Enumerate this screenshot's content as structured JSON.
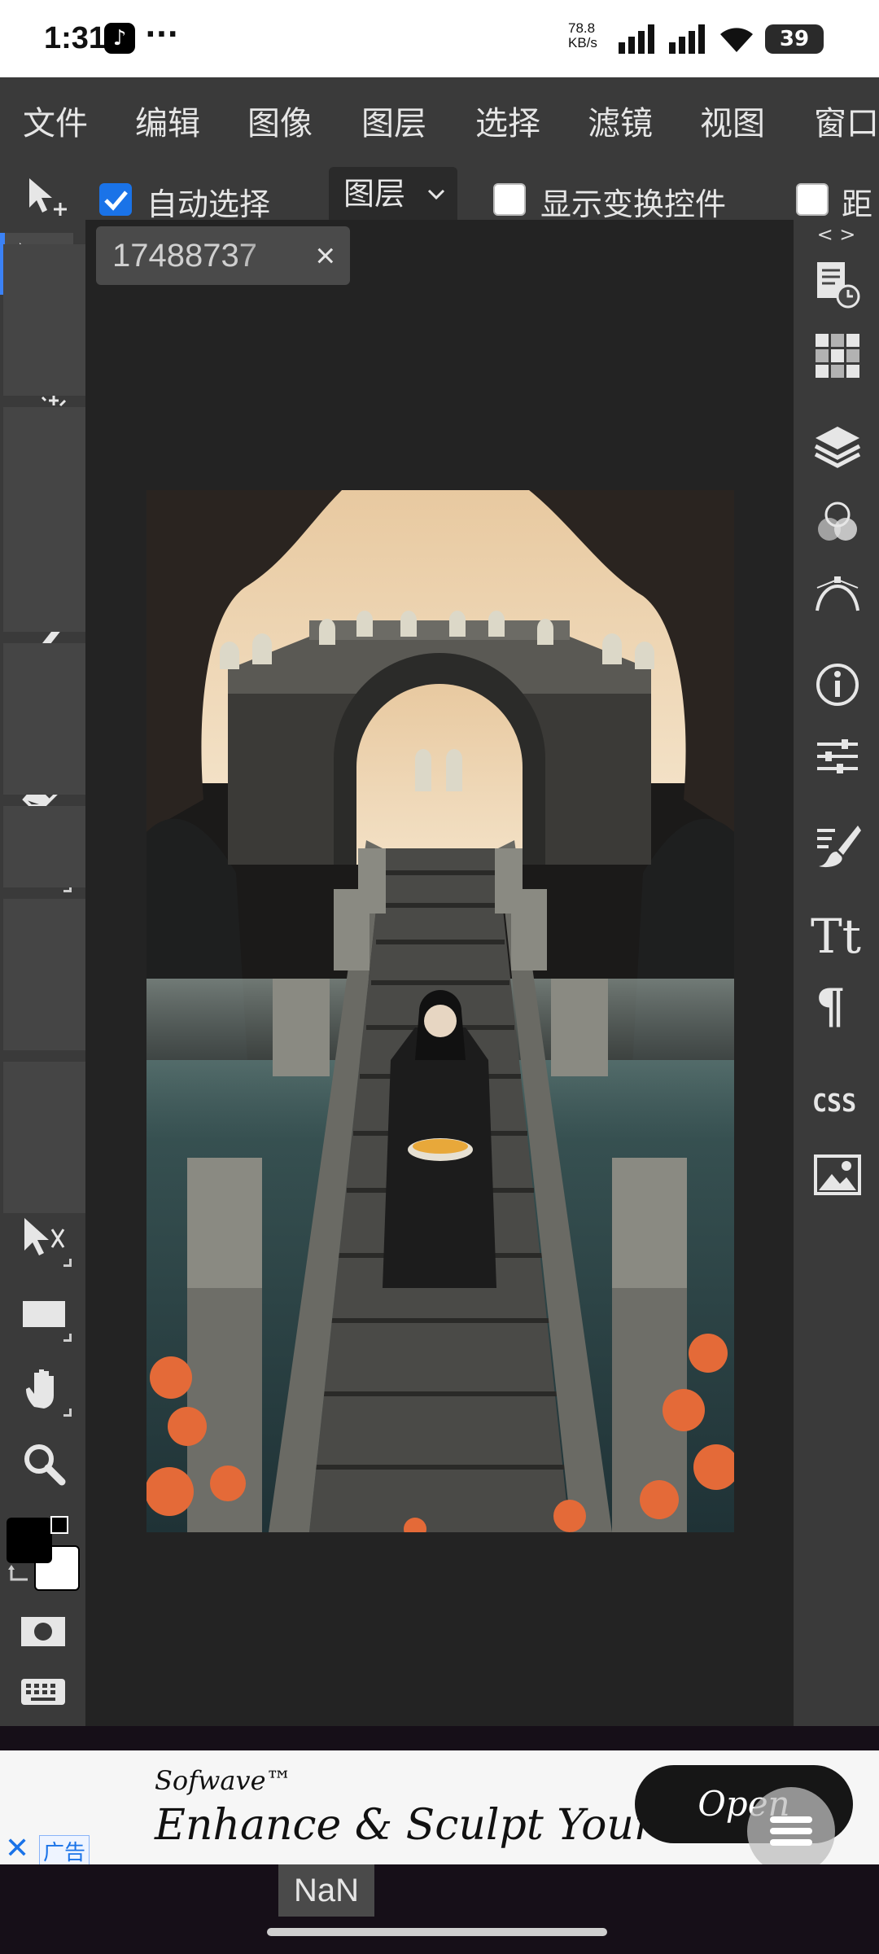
{
  "status_bar": {
    "time": "1:31",
    "dots": "···",
    "network_speed_value": "78.8",
    "network_speed_unit": "KB/s",
    "battery": "39"
  },
  "menu": {
    "items": [
      "文件",
      "编辑",
      "图像",
      "图层",
      "选择",
      "滤镜",
      "视图",
      "窗口"
    ]
  },
  "options_bar": {
    "auto_select_label": "自动选择",
    "auto_select_checked": true,
    "layer_dropdown": "图层",
    "show_transform_label": "显示变换控件",
    "show_transform_checked": false,
    "distance_label": "距"
  },
  "document": {
    "tab_name": "17488737",
    "close_glyph": "×"
  },
  "tools": [
    {
      "name": "move-tool",
      "active": true
    },
    {
      "name": "marquee-tool",
      "active": false
    },
    {
      "name": "magic-wand-tool",
      "active": false
    },
    {
      "name": "crop-tool",
      "active": false
    },
    {
      "name": "healing-tool",
      "active": false
    },
    {
      "name": "brush-tool",
      "active": false
    },
    {
      "name": "stamp-tool",
      "active": false
    },
    {
      "name": "eraser-tool",
      "active": false
    },
    {
      "name": "gradient-tool",
      "active": false
    },
    {
      "name": "blur-tool",
      "active": false
    },
    {
      "name": "dodge-tool",
      "active": false
    },
    {
      "name": "type-tool",
      "active": false
    },
    {
      "name": "pen-tool",
      "active": false
    },
    {
      "name": "path-select-tool",
      "active": false
    },
    {
      "name": "shape-tool",
      "active": false
    },
    {
      "name": "hand-tool",
      "active": false
    },
    {
      "name": "zoom-tool",
      "active": false
    }
  ],
  "colors": {
    "foreground": "#000000",
    "background": "#ffffff",
    "accent": "#1a73e8",
    "ui_panel": "#3a3a3a",
    "workspace": "#232323"
  },
  "right_panel": {
    "collapse_glyph": "< >",
    "type_label": "Tt",
    "paragraph_label": "¶",
    "css_label": "CSS"
  },
  "ad": {
    "brand": "Sofwave™",
    "tagline": "Enhance & Sculpt Your",
    "cta": "Open",
    "close_glyph": "✕",
    "ad_label": "广告"
  },
  "bottom": {
    "nan_label": "NaN"
  }
}
